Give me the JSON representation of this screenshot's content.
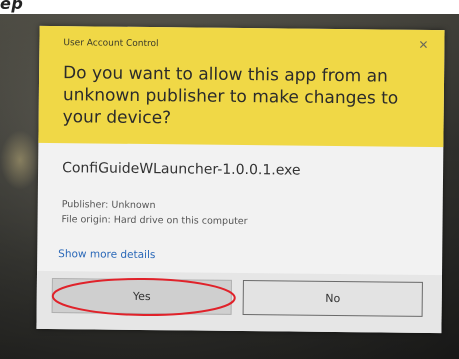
{
  "caption_fragment": "ep",
  "dialog": {
    "title": "User Account Control",
    "question": "Do you want to allow this app from an unknown publisher to make changes to your device?",
    "app_name": "ConfiGuideWLauncher-1.0.0.1.exe",
    "publisher": "Publisher: Unknown",
    "file_origin": "File origin: Hard drive on this computer",
    "details_link": "Show more details",
    "yes_label": "Yes",
    "no_label": "No",
    "close_icon": "close-icon"
  },
  "colors": {
    "header": "#f0d846",
    "body": "#f2f2f2",
    "link": "#2a68b8",
    "annotation": "#e0222a"
  }
}
